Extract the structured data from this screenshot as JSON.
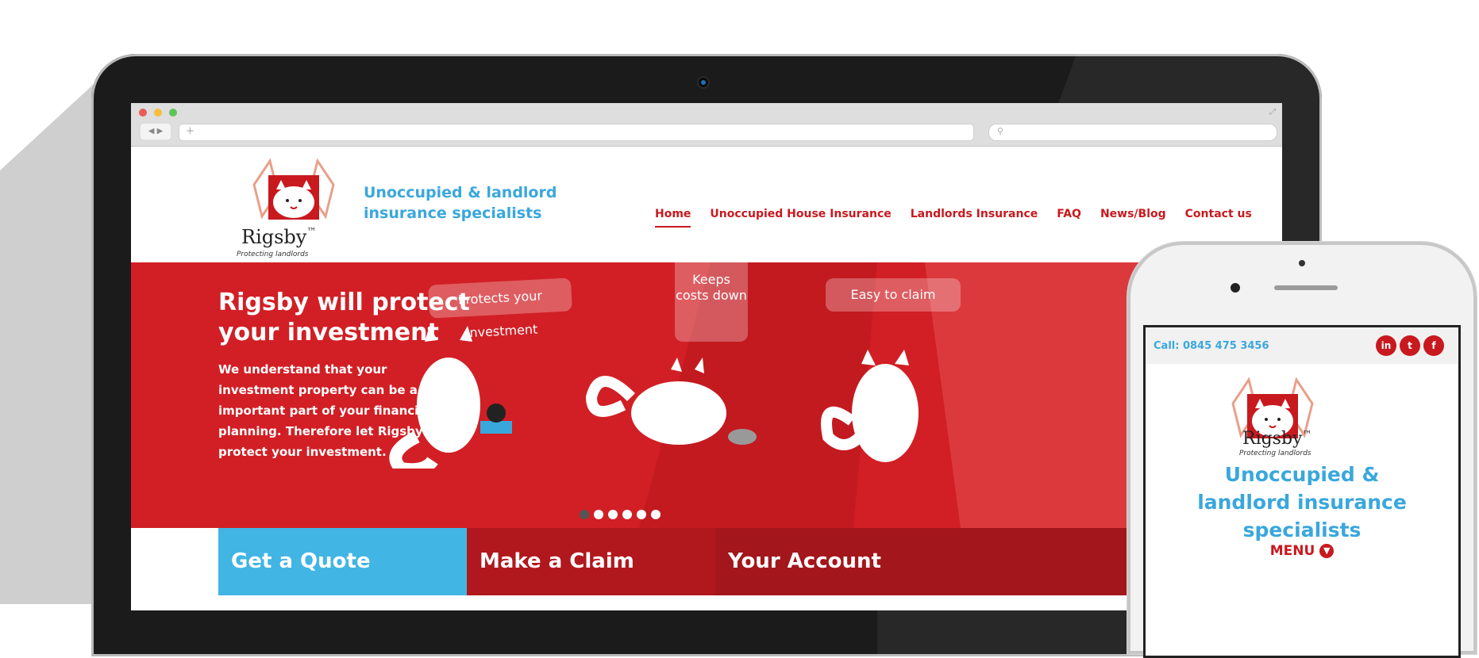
{
  "browser": {
    "nav_arrows": "◀ ▶",
    "new_tab_symbol": "+"
  },
  "site": {
    "logo_word": "Rigsby",
    "logo_tm": "™",
    "logo_sub": "Protecting landlords",
    "tagline_line1": "Unoccupied & landlord",
    "tagline_line2": "insurance specialists",
    "nav": [
      "Home",
      "Unoccupied House Insurance",
      "Landlords Insurance",
      "FAQ",
      "News/Blog",
      "Contact us"
    ],
    "nav_active": "Home"
  },
  "hero": {
    "title": "Rigsby will protect your investment",
    "text": "We understand that your investment property can be a very important part of your financial planning. Therefore let Rigsby protect your investment.",
    "bubble1": "Protects your investment",
    "bubble2": "Keeps costs down",
    "bubble3": "Easy to claim",
    "slide_count": 6,
    "active_slide": 0
  },
  "cta": {
    "quote": "Get a Quote",
    "claim": "Make a Claim",
    "account": "Your Account"
  },
  "phone": {
    "call": "Call: 0845 475 3456",
    "social": [
      "in",
      "t",
      "f"
    ],
    "logo_word": "Rigsby",
    "logo_tm": "™",
    "logo_sub": "Protecting landlords",
    "tagline": "Unoccupied & landlord insurance specialists",
    "menu": "MENU",
    "menu_icon": "chevron-down-icon"
  },
  "colors": {
    "brand_red": "#c8191f",
    "brand_blue": "#3aa7dc",
    "hero_red": "#d11f25"
  }
}
